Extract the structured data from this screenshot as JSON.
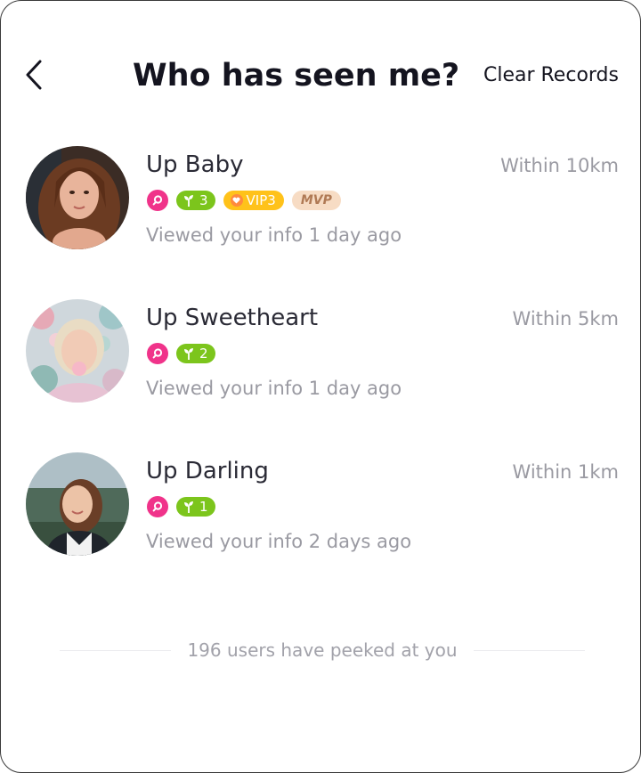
{
  "header": {
    "back_icon": "chevron-left-icon",
    "title": "Who has seen me?",
    "clear_label": "Clear Records"
  },
  "colors": {
    "search_badge": "#f0338a",
    "level_badge": "#7cc51c",
    "vip_badge": "#ffc21a",
    "mvp_badge_bg": "#f7dcc4",
    "mvp_badge_text": "#b07a55",
    "secondary_text": "#9a9aa2"
  },
  "viewers": [
    {
      "name": "Up Baby",
      "distance": "Within 10km",
      "level": "3",
      "vip": "VIP3",
      "mvp": "MVP",
      "viewed": "Viewed your info 1 day ago"
    },
    {
      "name": "Up Sweetheart",
      "distance": "Within 5km",
      "level": "2",
      "viewed": "Viewed your info 1 day ago"
    },
    {
      "name": "Up Darling",
      "distance": "Within 1km",
      "level": "1",
      "viewed": "Viewed your info 2 days ago"
    }
  ],
  "footer": {
    "text": "196 users have peeked at you"
  }
}
